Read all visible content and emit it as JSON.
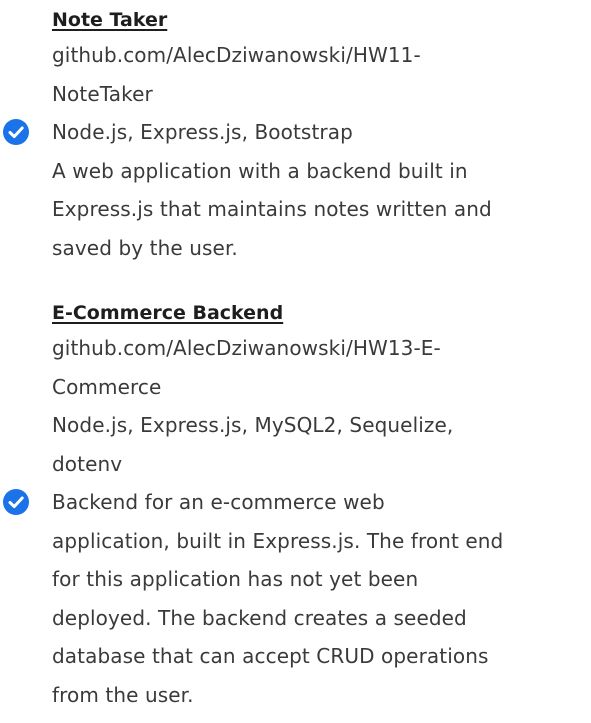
{
  "projects": [
    {
      "title": "Note Taker",
      "repo_line1": "github.com/AlecDziwanowski/HW11-",
      "repo_line2": "NoteTaker",
      "tech_line1": "Node.js, Express.js, Bootstrap",
      "desc_lines": [
        "A web application with a backend built in",
        "Express.js that maintains notes written and",
        "saved by the user."
      ]
    },
    {
      "title": "E-Commerce Backend",
      "repo_line1": "github.com/AlecDziwanowski/HW13-E-",
      "repo_line2": "Commerce",
      "tech_line1": "Node.js, Express.js, MySQL2, Sequelize,",
      "tech_line2": "dotenv",
      "desc_lines": [
        "Backend for an e-commerce web",
        "application, built in Express.js. The front end",
        "for this application has not yet been",
        "deployed. The backend creates a seeded",
        "database that can accept CRUD operations",
        "from the user."
      ]
    }
  ],
  "icons": {
    "check": "check-circle-icon",
    "check_color": "#1a73e8"
  }
}
